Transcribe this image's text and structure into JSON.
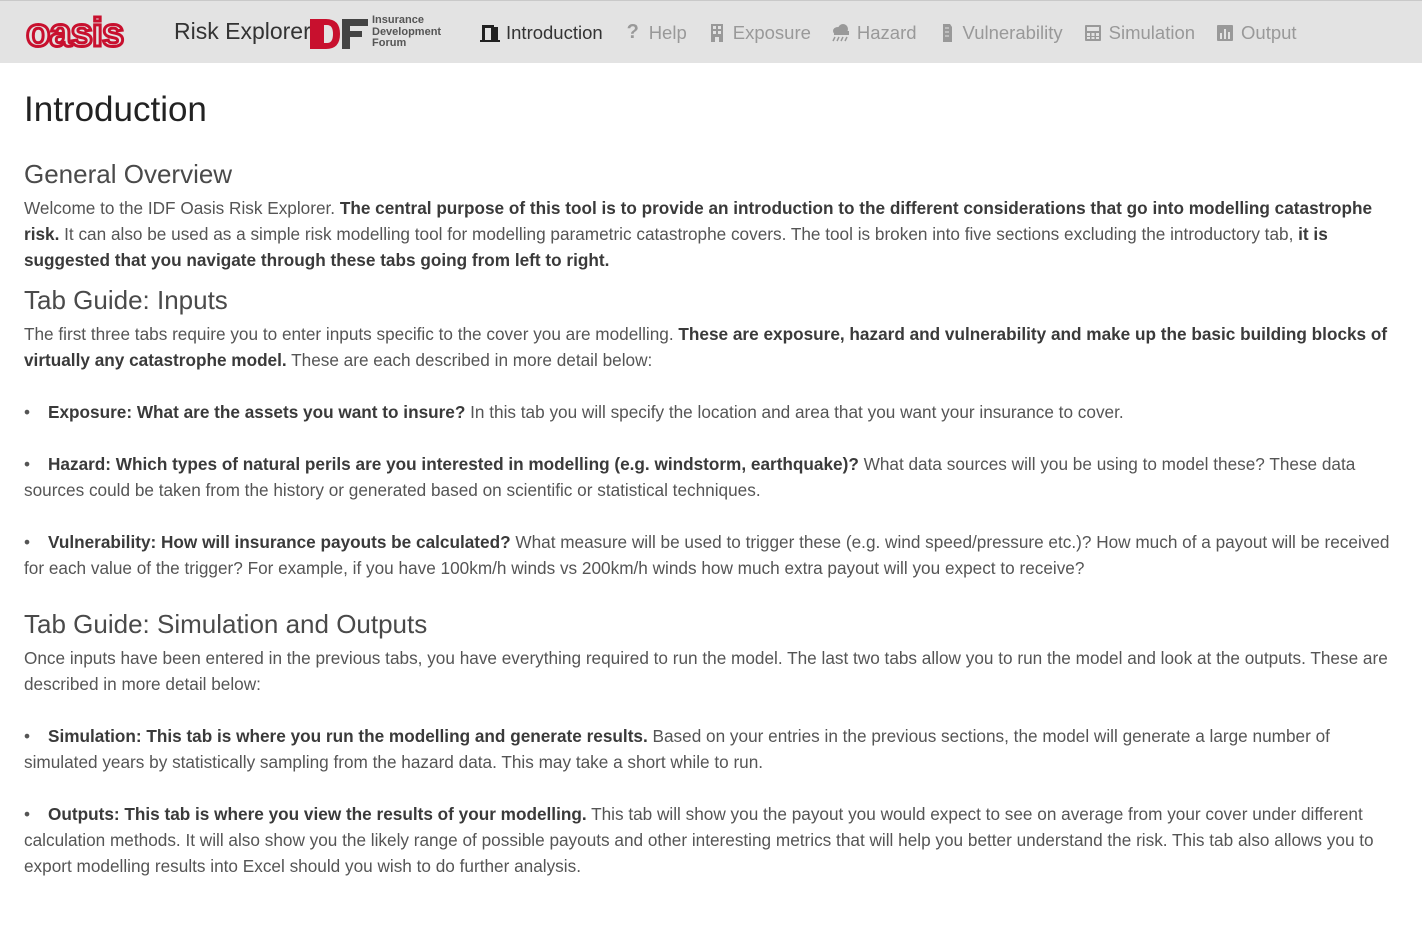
{
  "header": {
    "brand_name": "Risk Explorer",
    "logo_text": "oasis",
    "idf_logo_text": "IDF",
    "idf_line1": "Insurance",
    "idf_line2": "Development",
    "idf_line3": "Forum",
    "accent_color": "#c8102e",
    "nav": [
      {
        "label": "Introduction",
        "icon": "door-icon",
        "active": true
      },
      {
        "label": "Help",
        "icon": "question-icon",
        "active": false
      },
      {
        "label": "Exposure",
        "icon": "building-icon",
        "active": false
      },
      {
        "label": "Hazard",
        "icon": "cloud-rain-icon",
        "active": false
      },
      {
        "label": "Vulnerability",
        "icon": "file-icon",
        "active": false
      },
      {
        "label": "Simulation",
        "icon": "calculator-icon",
        "active": false
      },
      {
        "label": "Output",
        "icon": "bar-chart-icon",
        "active": false
      }
    ]
  },
  "page": {
    "title": "Introduction",
    "overview": {
      "heading": "General Overview",
      "p1_plain": "Welcome to the IDF Oasis Risk Explorer. ",
      "p1_bold": "The central purpose of this tool is to provide an introduction to the different considerations that go into modelling catastrophe risk.",
      "p1_plain2": " It can also be used as a simple risk modelling tool for modelling parametric catastrophe covers. The tool is broken into five sections excluding the introductory tab, ",
      "p1_bold2": "it is suggested that you navigate through these tabs going from left to right."
    },
    "inputs": {
      "heading": "Tab Guide: Inputs",
      "intro_plain": "The first three tabs require you to enter inputs specific to the cover you are modelling. ",
      "intro_bold": "These are exposure, hazard and vulnerability and make up the basic building blocks of virtually any catastrophe model.",
      "intro_plain2": " These are each described in more detail below:",
      "items": [
        {
          "bold": "Exposure: What are the assets you want to insure?",
          "text": " In this tab you will specify the location and area that you want your insurance to cover."
        },
        {
          "bold": "Hazard: Which types of natural perils are you interested in modelling (e.g. windstorm, earthquake)?",
          "text": " What data sources will you be using to model these? These data sources could be taken from the history or generated based on scientific or statistical techniques."
        },
        {
          "bold": "Vulnerability: How will insurance payouts be calculated?",
          "text": " What measure will be used to trigger these (e.g. wind speed/pressure etc.)? How much of a payout will be received for each value of the trigger? For example, if you have 100km/h winds vs 200km/h winds how much extra payout will you expect to receive?"
        }
      ]
    },
    "outputs": {
      "heading": "Tab Guide: Simulation and Outputs",
      "intro": "Once inputs have been entered in the previous tabs, you have everything required to run the model. The last two tabs allow you to run the model and look at the outputs. These are described in more detail below:",
      "items": [
        {
          "bold": "Simulation: This tab is where you run the modelling and generate results.",
          "text": " Based on your entries in the previous sections, the model will generate a large number of simulated years by statistically sampling from the hazard data. This may take a short while to run."
        },
        {
          "bold": "Outputs: This tab is where you view the results of your modelling.",
          "text": " This tab will show you the payout you would expect to see on average from your cover under different calculation methods. It will also show you the likely range of possible payouts and other interesting metrics that will help you better understand the risk. This tab also allows you to export modelling results into Excel should you wish to do further analysis."
        }
      ]
    }
  }
}
